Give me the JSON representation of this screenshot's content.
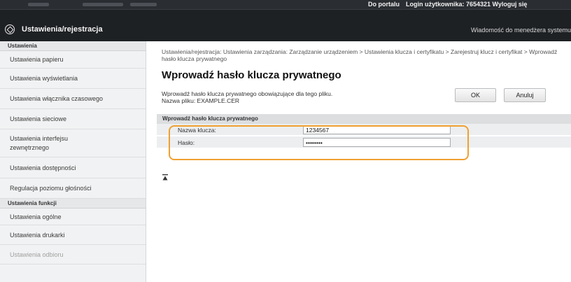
{
  "topbar": {
    "portal_link": "Do portalu",
    "login_text": "Login użytkownika:  7654321   Wyloguj się"
  },
  "header": {
    "title": "Ustawienia/rejestracja",
    "message_link": "Wiadomość do menedżera systemu"
  },
  "sidebar": {
    "section_settings": "Ustawienia",
    "items": [
      {
        "label": "Ustawienia papieru"
      },
      {
        "label": "Ustawienia wyświetlania"
      },
      {
        "label": "Ustawienia włącznika czasowego"
      },
      {
        "label": "Ustawienia sieciowe"
      },
      {
        "label": "Ustawienia interfejsu zewnętrznego"
      },
      {
        "label": "Ustawienia dostępności"
      },
      {
        "label": "Regulacja poziomu głośności"
      }
    ],
    "section_functions": "Ustawienia funkcji",
    "function_items": [
      {
        "label": "Ustawienia ogólne"
      },
      {
        "label": "Ustawienia drukarki"
      },
      {
        "label": "Ustawienia odbioru"
      }
    ]
  },
  "main": {
    "breadcrumb": "Ustawienia/rejestracja: Ustawienia zarządzania: Zarządzanie urządzeniem > Ustawienia klucza i certyfikatu > Zarejestruj klucz i certyfikat > Wprowadź hasło klucza prywatnego",
    "page_title": "Wprowadź hasło klucza prywatnego",
    "info_line1": "Wprowadź hasło klucza prywatnego obowiązujące dla tego pliku.",
    "info_line2": "Nazwa pliku: EXAMPLE.CER",
    "ok_button": "OK",
    "cancel_button": "Anuluj",
    "panel_title": "Wprowadź hasło klucza prywatnego",
    "key_name_label": "Nazwa klucza:",
    "key_name_value": "1234567",
    "password_label": "Hasło:",
    "password_value": "••••••••"
  },
  "colors": {
    "highlight": "#f0a030",
    "header_bg": "#1e2124",
    "sidebar_bg": "#f1f2f3"
  }
}
